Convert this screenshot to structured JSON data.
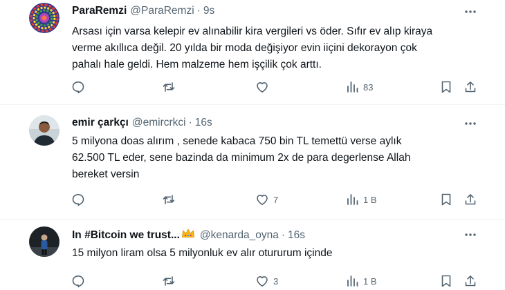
{
  "tweets": [
    {
      "name": "ParaRemzi",
      "handle": "@ParaRemzi",
      "time": "9s",
      "lines": [
        "Arsası için varsa kelepir ev alınabilir kira vergileri vs öder. Sıfır ev alıp kiraya",
        "verme akıllıca değil. 20 yılda bir moda değişiyor evin iiçini dekorayon çok",
        "pahalı hale geldi. Hem malzeme hem işçilik çok arttı."
      ],
      "replies": "",
      "retweets": "",
      "likes": "",
      "views": "83",
      "avatar_icon": "colorful-mandala-avatar"
    },
    {
      "name": "emir çarkçı",
      "handle": "@emircrkci",
      "time": "16s",
      "lines": [
        "5 milyona doas alırım , senede kabaca 750 bin TL temettü verse aylık",
        "62.500 TL eder, sene bazinda da minimum 2x de para degerlense Allah",
        "bereket versin"
      ],
      "replies": "",
      "retweets": "",
      "likes": "7",
      "views": "1 B",
      "avatar_icon": "person-photo-avatar"
    },
    {
      "name": "In #Bitcoin we trust...",
      "handle": "@kenarda_oyna",
      "time": "16s",
      "lines": [
        "15 milyon liram olsa 5 milyonluk ev alır otururum içinde"
      ],
      "replies": "",
      "retweets": "",
      "likes": "3",
      "views": "1 B",
      "avatar_icon": "person-silhouette-avatar",
      "badge_icon": "crown-emoji-icon"
    }
  ],
  "separator": "·",
  "colors": {
    "text_primary": "#0f1419",
    "text_secondary": "#536471",
    "divider": "#eff3f4"
  }
}
